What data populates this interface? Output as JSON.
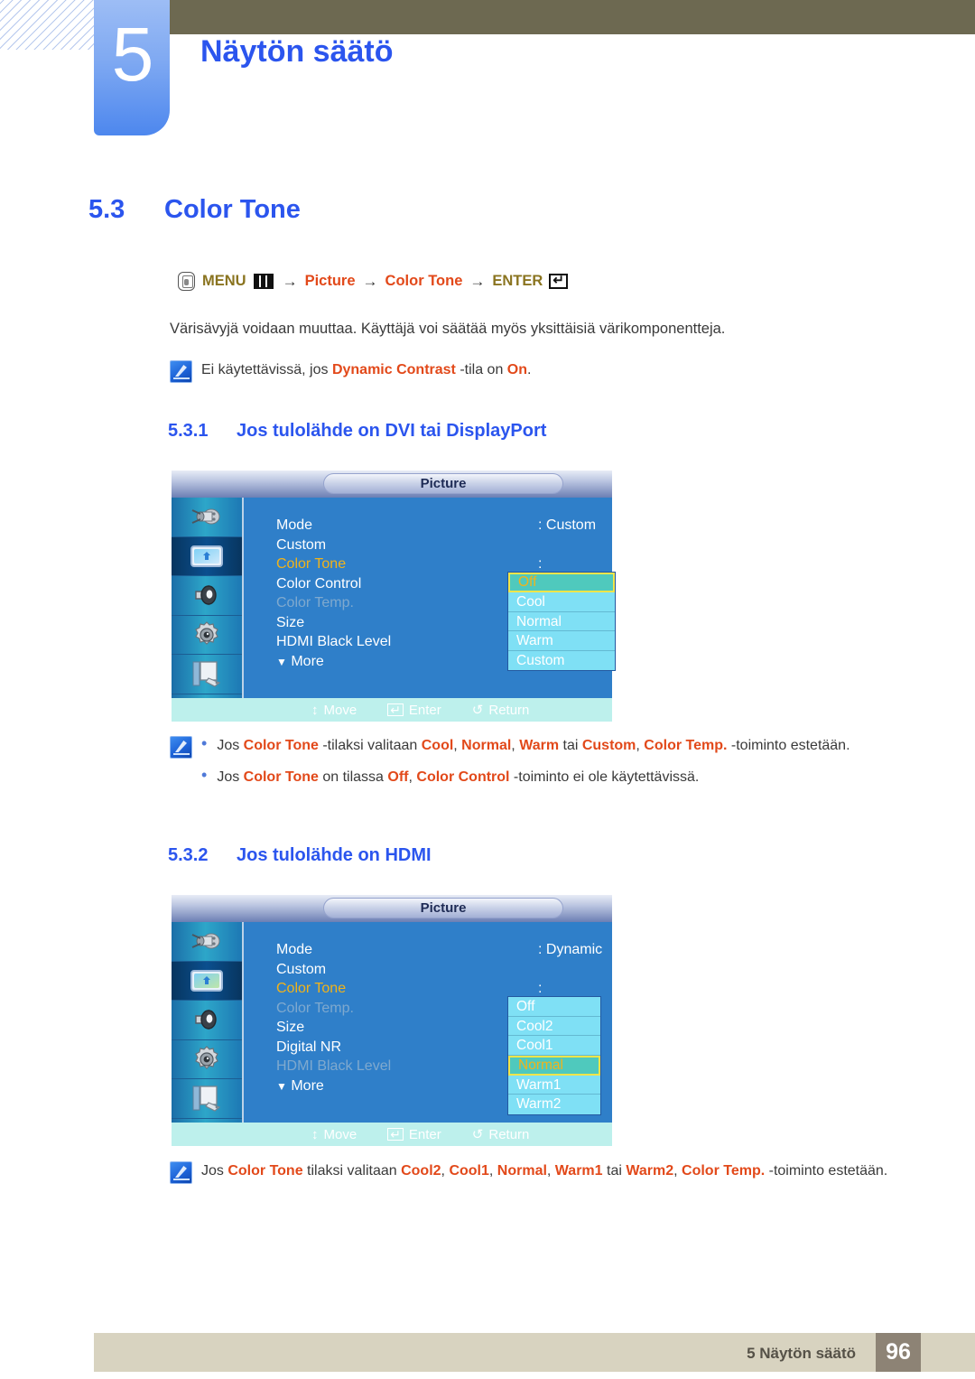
{
  "header": {
    "chapter_number": "5",
    "chapter_title": "Näytön säätö"
  },
  "section": {
    "number": "5.3",
    "title": "Color Tone"
  },
  "menu_path": {
    "remote_icon": "remote-button-icon",
    "menu_label": "MENU",
    "menu_icon": "menu-bars-icon",
    "arrow1": "→",
    "item1": "Picture",
    "arrow2": "→",
    "item2": "Color Tone",
    "arrow3": "→",
    "enter_label": "ENTER",
    "enter_icon": "enter-key-icon"
  },
  "intro_paragraph": "Värisävyjä voidaan muuttaa. Käyttäjä voi säätää myös yksittäisiä värikomponentteja.",
  "note_dynamic": {
    "icon": "note-pencil-icon",
    "prefix": "Ei käytettävissä, jos ",
    "term1": "Dynamic Contrast",
    "mid": " -tila on ",
    "term2": "On",
    "suffix": "."
  },
  "subsection_1": {
    "number": "5.3.1",
    "title": "Jos tulolähde on DVI tai DisplayPort"
  },
  "osd_1": {
    "title": "Picture",
    "sidebar_icons": [
      "input-source-icon",
      "picture-icon",
      "sound-icon",
      "setup-gear-icon",
      "multi-control-icon"
    ],
    "selected_sidebar_index": 1,
    "rows": [
      {
        "label": "Mode",
        "colon": ":",
        "value": "Custom",
        "state": "normal"
      },
      {
        "label": "Custom",
        "colon": "",
        "value": "",
        "state": "normal"
      },
      {
        "label": "Color Tone",
        "colon": ":",
        "value": "",
        "state": "highlight"
      },
      {
        "label": "Color Control",
        "colon": "",
        "value": "",
        "state": "normal"
      },
      {
        "label": "Color Temp.",
        "colon": ":",
        "value": "",
        "state": "dim"
      },
      {
        "label": "Size",
        "colon": ":",
        "value": "",
        "state": "normal"
      },
      {
        "label": "HDMI Black Level",
        "colon": ":",
        "value": "",
        "state": "normal"
      }
    ],
    "more_label": "More",
    "more_icon": "chevron-down-icon",
    "dropdown": {
      "items": [
        "Off",
        "Cool",
        "Normal",
        "Warm",
        "Custom"
      ],
      "selected_index": 0
    },
    "bottom_bar": {
      "move": "Move",
      "enter": "Enter",
      "return": "Return"
    }
  },
  "notes_1": {
    "icon": "note-pencil-icon",
    "bullets": [
      {
        "segments": [
          {
            "t": "Jos ",
            "hl": false
          },
          {
            "t": "Color Tone",
            "hl": true
          },
          {
            "t": " -tilaksi valitaan ",
            "hl": false
          },
          {
            "t": "Cool",
            "hl": true
          },
          {
            "t": ", ",
            "hl": false
          },
          {
            "t": "Normal",
            "hl": true
          },
          {
            "t": ", ",
            "hl": false
          },
          {
            "t": "Warm",
            "hl": true
          },
          {
            "t": " tai ",
            "hl": false
          },
          {
            "t": "Custom",
            "hl": true
          },
          {
            "t": ", ",
            "hl": false
          },
          {
            "t": "Color Temp.",
            "hl": true
          },
          {
            "t": " -toiminto estetään.",
            "hl": false
          }
        ]
      },
      {
        "segments": [
          {
            "t": "Jos ",
            "hl": false
          },
          {
            "t": "Color Tone",
            "hl": true
          },
          {
            "t": " on tilassa ",
            "hl": false
          },
          {
            "t": "Off",
            "hl": true
          },
          {
            "t": ", ",
            "hl": false
          },
          {
            "t": "Color Control",
            "hl": true
          },
          {
            "t": " -toiminto ei ole käytettävissä.",
            "hl": false
          }
        ]
      }
    ]
  },
  "subsection_2": {
    "number": "5.3.2",
    "title": "Jos tulolähde on HDMI"
  },
  "osd_2": {
    "title": "Picture",
    "sidebar_icons": [
      "input-source-icon",
      "picture-icon",
      "sound-icon",
      "setup-gear-icon",
      "multi-control-icon"
    ],
    "selected_sidebar_index": 1,
    "rows": [
      {
        "label": "Mode",
        "colon": ":",
        "value": "Dynamic",
        "state": "normal"
      },
      {
        "label": "Custom",
        "colon": "",
        "value": "",
        "state": "normal"
      },
      {
        "label": "Color Tone",
        "colon": ":",
        "value": "",
        "state": "highlight"
      },
      {
        "label": "Color Temp.",
        "colon": ":",
        "value": "",
        "state": "dim"
      },
      {
        "label": "Size",
        "colon": ":",
        "value": "",
        "state": "normal"
      },
      {
        "label": "Digital NR",
        "colon": ":",
        "value": "",
        "state": "normal"
      },
      {
        "label": "HDMI Black Level",
        "colon": ":",
        "value": "",
        "state": "dim"
      }
    ],
    "more_label": "More",
    "more_icon": "chevron-down-icon",
    "dropdown": {
      "items": [
        "Off",
        "Cool2",
        "Cool1",
        "Normal",
        "Warm1",
        "Warm2"
      ],
      "selected_index": 3
    },
    "bottom_bar": {
      "move": "Move",
      "enter": "Enter",
      "return": "Return"
    }
  },
  "notes_2": {
    "icon": "note-pencil-icon",
    "bullets": [
      {
        "segments": [
          {
            "t": "Jos ",
            "hl": false
          },
          {
            "t": "Color Tone",
            "hl": true
          },
          {
            "t": " tilaksi valitaan ",
            "hl": false
          },
          {
            "t": "Cool2",
            "hl": true
          },
          {
            "t": ", ",
            "hl": false
          },
          {
            "t": "Cool1",
            "hl": true
          },
          {
            "t": ", ",
            "hl": false
          },
          {
            "t": "Normal",
            "hl": true
          },
          {
            "t": ", ",
            "hl": false
          },
          {
            "t": "Warm1",
            "hl": true
          },
          {
            "t": " tai ",
            "hl": false
          },
          {
            "t": "Warm2",
            "hl": true
          },
          {
            "t": ", ",
            "hl": false
          },
          {
            "t": "Color Temp.",
            "hl": true
          },
          {
            "t": " -toiminto estetään.",
            "hl": false
          }
        ]
      }
    ]
  },
  "footer": {
    "text": "5 Näytön säätö",
    "page_number": "96"
  },
  "colors": {
    "heading_blue": "#2b55ee",
    "accent_orange": "#e2491a",
    "menu_olive": "#8a7420",
    "osd_blue": "#2f7fc9",
    "osd_dropdown": "#7fe0f5",
    "osd_selected": "#4fc9bd",
    "osd_selected_border": "#f2e54a",
    "osd_highlight_text": "#f2b319",
    "footer_bar": "#d8d3c0",
    "footer_page_box": "#8d8375",
    "olive_bar": "#6d6951"
  }
}
